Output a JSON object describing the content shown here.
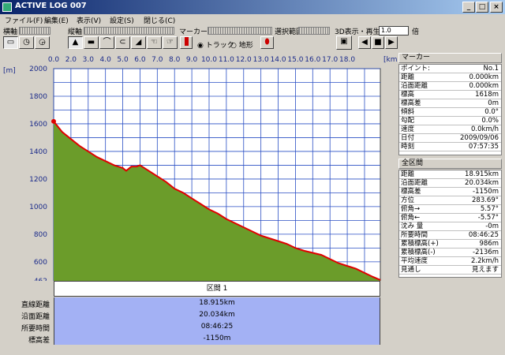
{
  "window": {
    "title": "ACTIVE LOG 007",
    "minimize": "_",
    "maximize": "□",
    "close": "×"
  },
  "menu": [
    "ファイル(F)",
    "編集(E)",
    "表示(V)",
    "設定(S)",
    "閉じる(C)"
  ],
  "toolbar": {
    "h_axis": "横軸",
    "v_axis": "縦軸",
    "marker": "マーカー",
    "select_range": "選択範囲",
    "view3d": "3D表示・再生",
    "speed": "1.0",
    "magnify": "倍",
    "track": "トラック",
    "terrain": "地形",
    "play": "▶"
  },
  "chart_data": {
    "type": "area",
    "x_unit": "[km]",
    "y_unit": "[m]",
    "xticks": [
      "0.0",
      "2.0",
      "3.0",
      "4.0",
      "5.0",
      "6.0",
      "7.0",
      "8.0",
      "9.0",
      "10.0",
      "11.0",
      "12.0",
      "13.0",
      "14.0",
      "15.0",
      "16.0",
      "17.0",
      "18.0"
    ],
    "yticks": [
      "2000",
      "1800",
      "1600",
      "1400",
      "1200",
      "1000",
      "800",
      "600",
      "462"
    ],
    "xlim": [
      0,
      18.915
    ],
    "ylim": [
      462,
      2000
    ],
    "x": [
      0,
      0.5,
      1,
      1.5,
      2,
      2.5,
      3,
      3.5,
      4,
      4.2,
      4.5,
      4.8,
      5,
      5.5,
      6,
      6.5,
      7,
      7.5,
      8,
      8.5,
      9,
      9.5,
      10,
      10.5,
      11,
      11.5,
      12,
      12.5,
      13,
      13.5,
      14,
      14.5,
      15,
      15.5,
      16,
      16.5,
      17,
      17.5,
      18,
      18.5,
      18.915
    ],
    "y": [
      1618,
      1540,
      1490,
      1440,
      1400,
      1360,
      1330,
      1300,
      1280,
      1260,
      1290,
      1290,
      1300,
      1260,
      1220,
      1180,
      1130,
      1100,
      1060,
      1020,
      980,
      950,
      910,
      880,
      850,
      820,
      790,
      770,
      750,
      730,
      700,
      680,
      665,
      650,
      620,
      590,
      570,
      550,
      520,
      490,
      468
    ],
    "color_area": "#6b9c2a",
    "color_track": "#e00000",
    "grid": true
  },
  "section": {
    "title": "区間 1",
    "labels": [
      "直線距離",
      "沿面距離",
      "所要時間",
      "標高差"
    ],
    "values": [
      "18.915km",
      "20.034km",
      "08:46:25",
      "-1150m"
    ]
  },
  "marker_panel": {
    "title": "マーカー",
    "rows": [
      {
        "k": "ポイント:",
        "v": "No.1"
      },
      {
        "k": "距離",
        "v": "0.000km"
      },
      {
        "k": "沿面距離",
        "v": "0.000km"
      },
      {
        "k": "標高",
        "v": "1618m"
      },
      {
        "k": "標高差",
        "v": "0m"
      },
      {
        "k": "傾斜",
        "v": "0.0°"
      },
      {
        "k": "勾配",
        "v": "0.0%"
      },
      {
        "k": "速度",
        "v": "0.0km/h"
      },
      {
        "k": "日付",
        "v": "2009/09/06"
      },
      {
        "k": "時刻",
        "v": "07:57:35"
      }
    ]
  },
  "total_panel": {
    "title": "全区間",
    "rows": [
      {
        "k": "距離",
        "v": "18.915km"
      },
      {
        "k": "沿面距離",
        "v": "20.034km"
      },
      {
        "k": "標高差",
        "v": "-1150m"
      },
      {
        "k": "方位",
        "v": "283.69°"
      },
      {
        "k": "俯角→",
        "v": "5.57°"
      },
      {
        "k": "俯角←",
        "v": "-5.57°"
      },
      {
        "k": "沈み 量",
        "v": "-0m"
      },
      {
        "k": "所要時間",
        "v": "08:46:25"
      },
      {
        "k": "累積標高(+)",
        "v": "986m"
      },
      {
        "k": "累積標高(-)",
        "v": "-2136m"
      },
      {
        "k": "平均速度",
        "v": "2.2km/h"
      },
      {
        "k": "見通し",
        "v": "見えます"
      }
    ]
  }
}
